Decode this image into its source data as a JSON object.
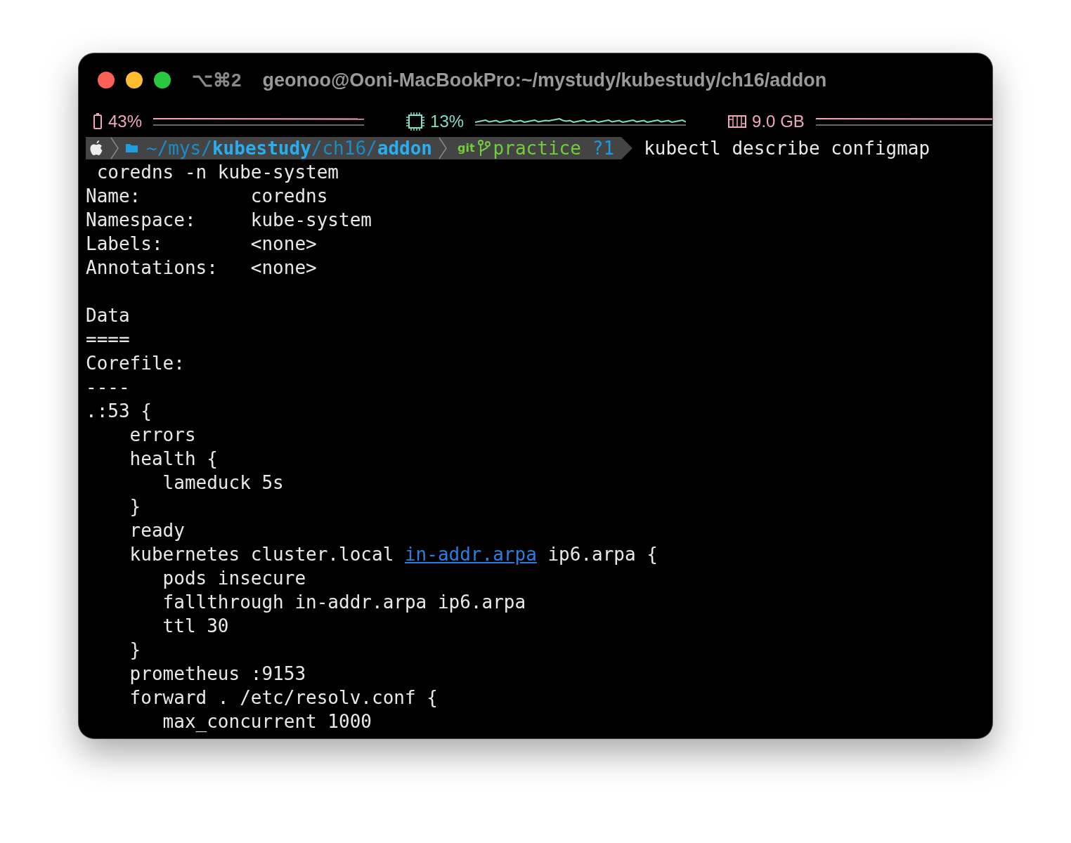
{
  "window": {
    "shortcut": "⌥⌘2",
    "title": "geonoo@Ooni-MacBookPro:~/mystudy/kubestudy/ch16/addon"
  },
  "status_bar": [
    {
      "kind": "battery",
      "reading": "43%",
      "color": "#f0a8b8"
    },
    {
      "kind": "cpu",
      "reading": "13%",
      "color": "#7fe0c8"
    },
    {
      "kind": "memory",
      "reading": "9.0 GB",
      "color": "#f0a8b8"
    }
  ],
  "prompt": {
    "path": [
      {
        "text": "~/mys/",
        "bold": false
      },
      {
        "text": "kubestudy",
        "bold": true
      },
      {
        "text": "/ch16/",
        "bold": false
      },
      {
        "text": "addon",
        "bold": true
      }
    ],
    "git_label": "git",
    "branch": "practice",
    "git_status": "?1",
    "command": [
      "kubectl describe configmap",
      " coredns -n kube-system"
    ]
  },
  "output": [
    {
      "segments": [
        {
          "text": "Name:          coredns"
        }
      ]
    },
    {
      "segments": [
        {
          "text": "Namespace:     kube-system"
        }
      ]
    },
    {
      "segments": [
        {
          "text": "Labels:        <none>"
        }
      ]
    },
    {
      "segments": [
        {
          "text": "Annotations:   <none>"
        }
      ]
    },
    {
      "kind": "blank"
    },
    {
      "segments": [
        {
          "text": "Data"
        }
      ]
    },
    {
      "segments": [
        {
          "text": "===="
        }
      ]
    },
    {
      "segments": [
        {
          "text": "Corefile:"
        }
      ]
    },
    {
      "segments": [
        {
          "text": "----"
        }
      ]
    },
    {
      "segments": [
        {
          "text": ".:53 {"
        }
      ]
    },
    {
      "segments": [
        {
          "text": "    errors"
        }
      ]
    },
    {
      "segments": [
        {
          "text": "    health {"
        }
      ]
    },
    {
      "segments": [
        {
          "text": "       lameduck 5s"
        }
      ]
    },
    {
      "segments": [
        {
          "text": "    }"
        }
      ]
    },
    {
      "segments": [
        {
          "text": "    ready"
        }
      ]
    },
    {
      "segments": [
        {
          "text": "    kubernetes cluster.local "
        },
        {
          "text": "in-addr.arpa",
          "kind": "link"
        },
        {
          "text": " ip6.arpa {"
        }
      ]
    },
    {
      "segments": [
        {
          "text": "       pods insecure"
        }
      ]
    },
    {
      "segments": [
        {
          "text": "       fallthrough in-addr.arpa ip6.arpa"
        }
      ]
    },
    {
      "segments": [
        {
          "text": "       ttl 30"
        }
      ]
    },
    {
      "segments": [
        {
          "text": "    }"
        }
      ]
    },
    {
      "segments": [
        {
          "text": "    prometheus :9153"
        }
      ]
    },
    {
      "segments": [
        {
          "text": "    forward . /etc/resolv.conf {"
        }
      ]
    },
    {
      "segments": [
        {
          "text": "       max_concurrent 1000"
        }
      ]
    }
  ]
}
